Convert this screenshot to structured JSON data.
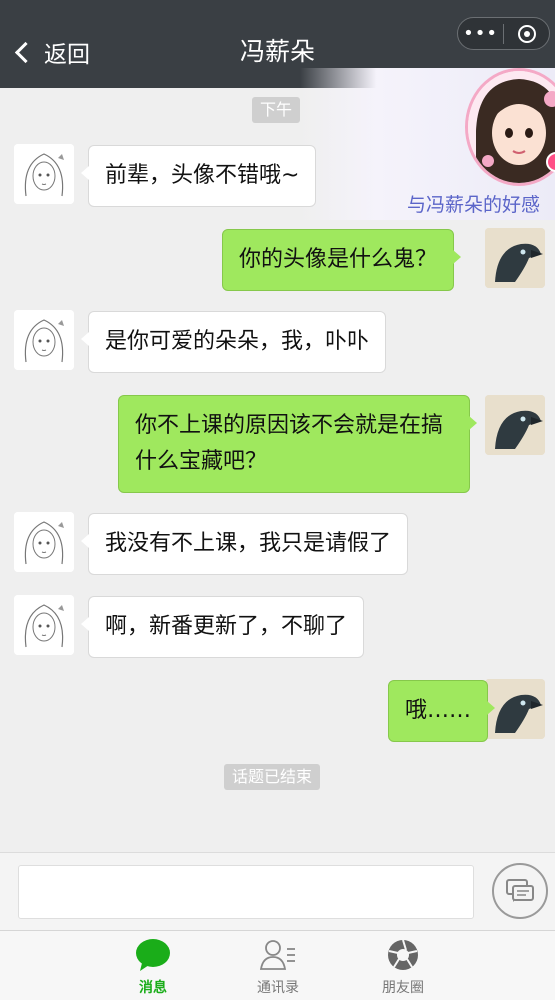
{
  "header": {
    "back_label": "返回",
    "title": "冯薪朵",
    "more_icon": "more-dots-icon",
    "close_icon": "target-circle-icon"
  },
  "affection": {
    "label": "与冯薪朵的好感",
    "portrait_icon": "avatar-portrait"
  },
  "chat": {
    "time_label": "下午",
    "messages": [
      {
        "side": "left",
        "text": "前辈，头像不错哦~"
      },
      {
        "side": "right",
        "text": "你的头像是什么鬼？"
      },
      {
        "side": "left",
        "text": "是你可爱的朵朵，我，卟卟"
      },
      {
        "side": "right",
        "text": "你不上课的原因该不会就是在搞什么宝藏吧？"
      },
      {
        "side": "left",
        "text": "我没有不上课，我只是请假了"
      },
      {
        "side": "left",
        "text": "啊，新番更新了，不聊了"
      },
      {
        "side": "right",
        "text": "哦……"
      }
    ],
    "end_label": "话题已结束"
  },
  "input": {
    "value": "",
    "placeholder": ""
  },
  "tabs": [
    {
      "label": "消息",
      "icon": "chat-bubble-icon",
      "active": true
    },
    {
      "label": "通讯录",
      "icon": "contacts-icon",
      "active": false
    },
    {
      "label": "朋友圈",
      "icon": "moments-aperture-icon",
      "active": false
    }
  ],
  "colors": {
    "header_bg": "#3a3f44",
    "self_bubble": "#9fe85e",
    "other_bubble": "#ffffff",
    "active_tab": "#1aad19",
    "affection_text": "#5b65c9"
  }
}
